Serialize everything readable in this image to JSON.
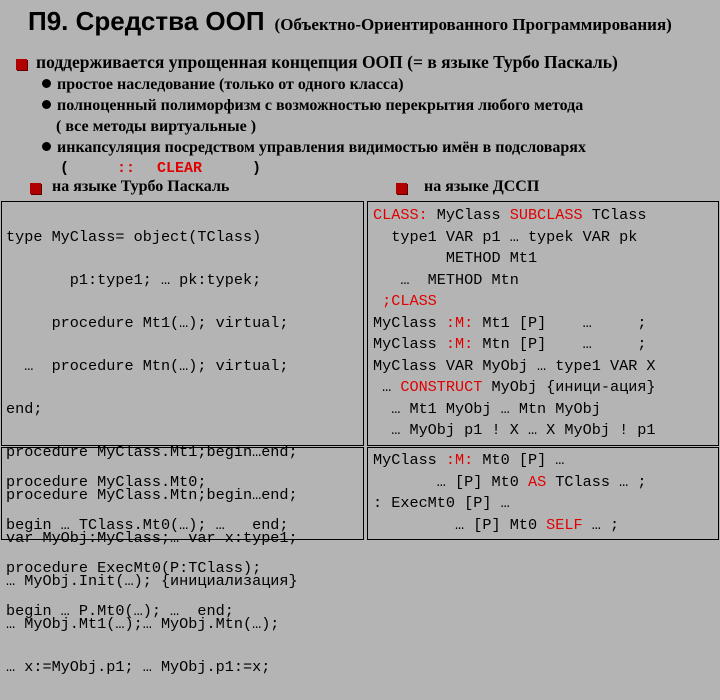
{
  "header": {
    "title": "П9. Средства ООП",
    "subtitle": "(Объектно-Ориентированного Программирования)"
  },
  "intro": "поддерживается упрощенная концепция ООП (= в языке Турбо Паскаль)",
  "bullets": [
    "простое наследование (только от одного класса)",
    "полноценный полиморфизм с возможностью перекрытия любого метода",
    "( все методы виртуальные )",
    "инкапсуляция посредством управления видимостью имён в подсловарях"
  ],
  "syntax_line": {
    "open": "(",
    "colons": "::",
    "clear": "CLEAR",
    "close": ")"
  },
  "left_heading": "на языке Турбо Паскаль",
  "right_heading": "на языке ДССП",
  "colors": {
    "background": "#b4b4b4",
    "keyword": "#e00000",
    "bullet_square": "#b00000"
  },
  "left_code_top": [
    "type MyClass= object(TClass)",
    "       p1:type1; … pk:typek;",
    "     procedure Mt1(…); virtual;",
    "  …  procedure Mtn(…); virtual;",
    "end;",
    "procedure MyClass.Mt1;begin…end;",
    "procedure MyClass.Mtn;begin…end;",
    "var MyObj:MyClass;… var x:type1;",
    "… MyObj.Init(…); {инициализация}",
    "… MyObj.Mt1(…);… MyObj.Mtn(…);",
    "… x:=MyObj.p1; … MyObj.p1:=x;"
  ],
  "left_code_bottom": [
    "procedure MyClass.Mt0;",
    "begin … TClass.Mt0(…); …   end;",
    "procedure ExecMt0(P:TClass);",
    "begin … P.Mt0(…); …  end;"
  ],
  "right_code_top": [
    [
      {
        "t": "CLASS:",
        "r": true
      },
      {
        "t": " MyClass "
      },
      {
        "t": "SUBCLASS",
        "r": true
      },
      {
        "t": " TClass"
      }
    ],
    [
      {
        "t": "  type1 VAR p1 … typek VAR pk"
      }
    ],
    [
      {
        "t": "        METHOD Mt1"
      }
    ],
    [
      {
        "t": "   …  METHOD Mtn"
      }
    ],
    [
      {
        "t": " ;CLASS",
        "r": true
      }
    ],
    [
      {
        "t": "MyClass "
      },
      {
        "t": ":M:",
        "r": true
      },
      {
        "t": " Mt1 [P]    …     ;"
      }
    ],
    [
      {
        "t": "MyClass "
      },
      {
        "t": ":M:",
        "r": true
      },
      {
        "t": " Mtn [P]    …     ;"
      }
    ],
    [
      {
        "t": "MyClass VAR MyObj … type1 VAR X"
      }
    ],
    [
      {
        "t": " … "
      },
      {
        "t": "CONSTRUCT",
        "r": true
      },
      {
        "t": " MyObj {иници-ация}"
      }
    ],
    [
      {
        "t": "  … Mt1 MyObj … Mtn MyObj"
      }
    ],
    [
      {
        "t": "  … MyObj p1 ! X … X MyObj ! p1"
      }
    ]
  ],
  "right_code_bottom": [
    [
      {
        "t": "MyClass "
      },
      {
        "t": ":M:",
        "r": true
      },
      {
        "t": " Mt0 [P] …"
      }
    ],
    [
      {
        "t": "       … [P] Mt0 "
      },
      {
        "t": "AS",
        "r": true
      },
      {
        "t": " TClass … ;"
      }
    ],
    [
      {
        "t": ": ExecMt0 [P] …"
      }
    ],
    [
      {
        "t": "         … [P] Mt0 "
      },
      {
        "t": "SELF",
        "r": true
      },
      {
        "t": " … ;"
      }
    ]
  ]
}
